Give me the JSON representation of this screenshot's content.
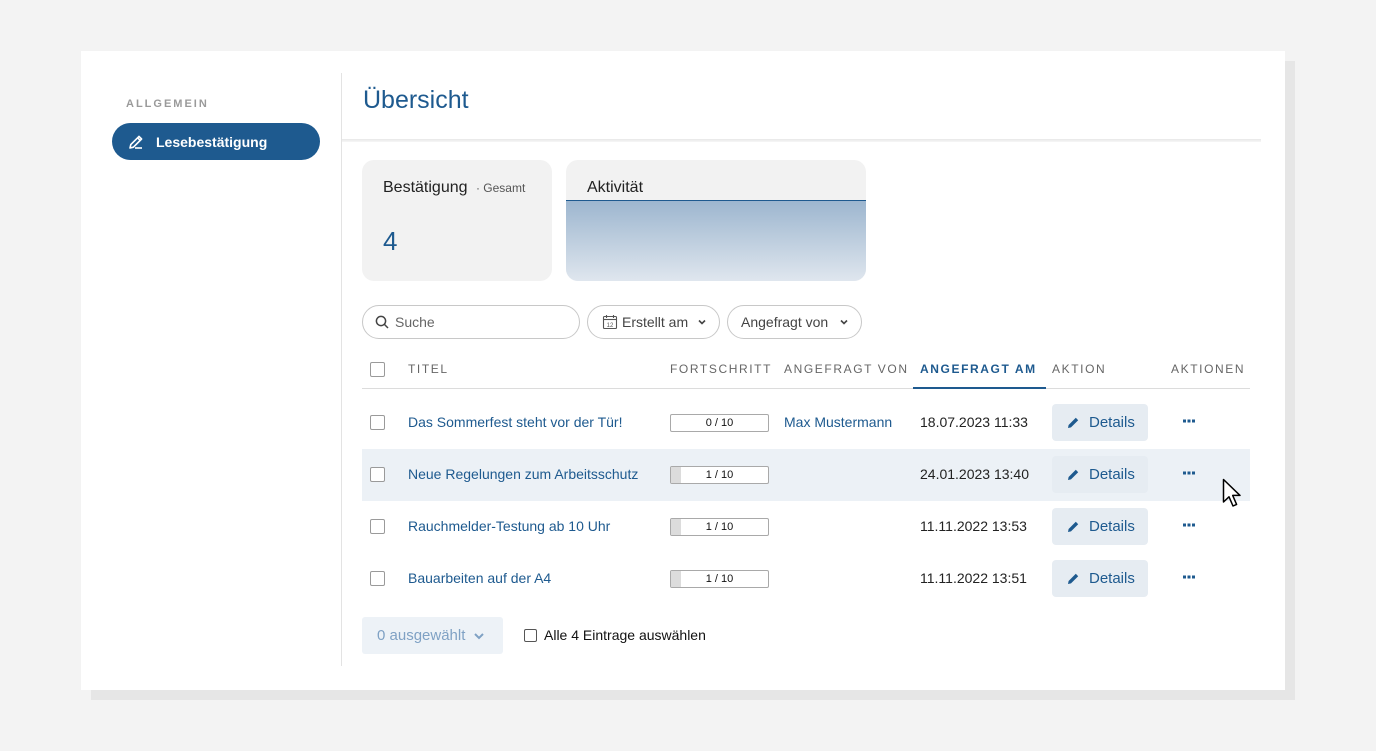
{
  "sidebar": {
    "heading": "ALLGEMEIN",
    "items": [
      {
        "label": "Lesebestätigung",
        "icon": "pencil-icon"
      }
    ]
  },
  "header": {
    "title": "Übersicht"
  },
  "cards": {
    "confirmation": {
      "title": "Bestätigung",
      "subtitle": "· Gesamt",
      "value": "4"
    },
    "activity": {
      "title": "Aktivität"
    }
  },
  "filters": {
    "search_placeholder": "Suche",
    "created_label": "Erstellt am",
    "requested_by_label": "Angefragt von"
  },
  "table": {
    "columns": {
      "title": "TITEL",
      "progress": "FORTSCHRITT",
      "requested_by": "ANGEFRAGT VON",
      "requested_at": "ANGEFRAGT AM",
      "action": "AKTION",
      "actions": "AKTIONEN"
    },
    "sorted_column": "requested_at",
    "rows": [
      {
        "title": "Das Sommerfest steht vor der Tür!",
        "progress_text": "0 / 10",
        "progress": 0.0,
        "requested_by": "Max Mustermann",
        "requested_at": "18.07.2023 11:33",
        "action": "Details"
      },
      {
        "title": "Neue Regelungen zum Arbeitsschutz",
        "progress_text": "1 / 10",
        "progress": 0.1,
        "requested_by": "",
        "requested_at": "24.01.2023 13:40",
        "action": "Details"
      },
      {
        "title": "Rauchmelder-Testung ab 10 Uhr",
        "progress_text": "1 / 10",
        "progress": 0.1,
        "requested_by": "",
        "requested_at": "11.11.2022 13:53",
        "action": "Details"
      },
      {
        "title": "Bauarbeiten auf der A4",
        "progress_text": "1 / 10",
        "progress": 0.1,
        "requested_by": "",
        "requested_at": "11.11.2022 13:51",
        "action": "Details"
      }
    ],
    "hovered_row": 1
  },
  "footer": {
    "selected_label": "0 ausgewählt",
    "select_all_label": "Alle 4 Eintrage auswählen"
  },
  "colors": {
    "primary": "#1e5a8f",
    "row_highlight": "#ecf1f6",
    "details_bg": "#e6ecf2",
    "card_bg": "#f2f2f2"
  }
}
